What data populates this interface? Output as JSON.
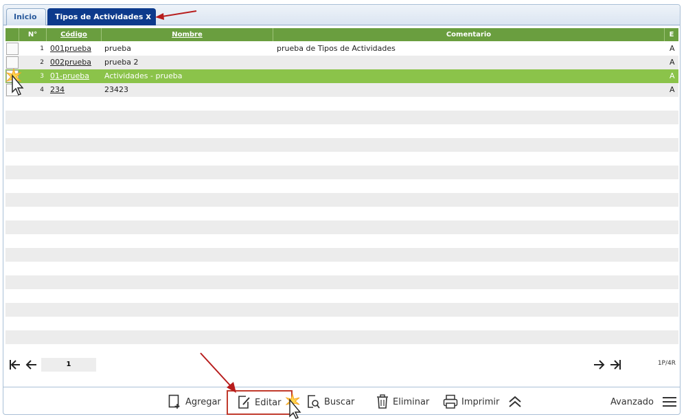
{
  "tabs": {
    "inicio": "Inicio",
    "active": "Tipos de Actividades",
    "close": "x"
  },
  "grid": {
    "headers": {
      "num": "N°",
      "codigo": "Código",
      "nombre": "Nombre",
      "comentario": "Comentario",
      "e": "E"
    },
    "rows": [
      {
        "num": "1",
        "codigo": "001prueba",
        "nombre": "prueba",
        "comentario": "prueba de Tipos de Actividades",
        "e": "A"
      },
      {
        "num": "2",
        "codigo": "002prueba",
        "nombre": "prueba 2",
        "comentario": "",
        "e": "A"
      },
      {
        "num": "3",
        "codigo": "01-prueba",
        "nombre": "Actividades - prueba",
        "comentario": "",
        "e": "A"
      },
      {
        "num": "4",
        "codigo": "234",
        "nombre": "23423",
        "comentario": "",
        "e": "A"
      }
    ],
    "selected_row": 2
  },
  "pager": {
    "page": "1",
    "info": "1P/4R"
  },
  "toolbar": {
    "agregar": "Agregar",
    "editar": "Editar",
    "buscar": "Buscar",
    "eliminar": "Eliminar",
    "imprimir": "Imprimir",
    "avanzado": "Avanzado"
  },
  "colors": {
    "header_green": "#6a9e3f",
    "selected_green": "#8bc34a",
    "active_tab": "#0d3a8c",
    "highlight_red": "#c0392b"
  }
}
